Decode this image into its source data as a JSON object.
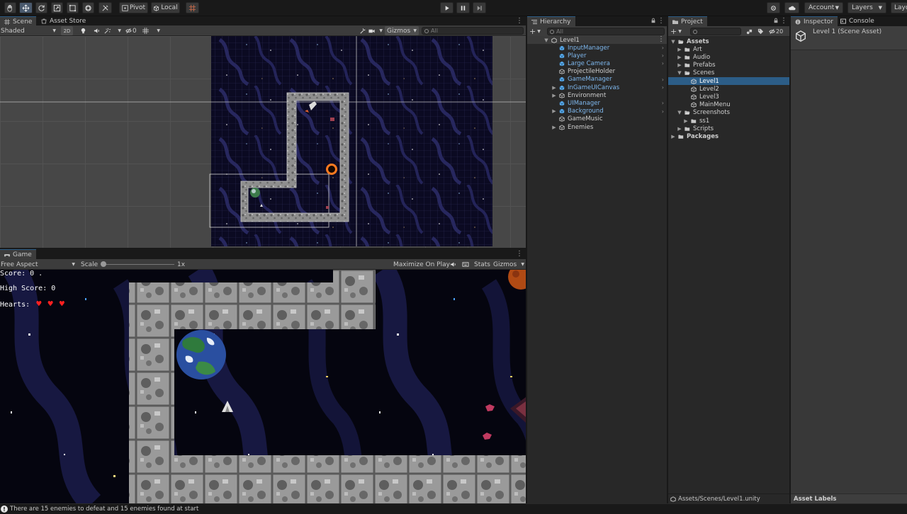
{
  "toolbar": {
    "pivot": "Pivot",
    "local": "Local",
    "account": "Account",
    "layers": "Layers",
    "layout": "Layo"
  },
  "scene": {
    "tabs": {
      "scene": "Scene",
      "asset_store": "Asset Store"
    },
    "shading": "Shaded",
    "mode_2d": "2D",
    "hidden_count": "0",
    "gizmos": "Gizmos",
    "search_placeholder": "All"
  },
  "game": {
    "tab": "Game",
    "aspect": "Free Aspect",
    "scale_label": "Scale",
    "scale_value": "1x",
    "maximize": "Maximize On Play",
    "stats": "Stats",
    "gizmos": "Gizmos",
    "hud": {
      "score": "Score: 0 .",
      "high_score": "High Score: 0",
      "hearts_label": "Hearts:",
      "hearts": [
        "♥",
        "♥",
        "♥"
      ]
    }
  },
  "hierarchy": {
    "tab": "Hierarchy",
    "search_placeholder": "All",
    "scene_name": "Level1",
    "items": [
      {
        "label": "InputManager",
        "prefab": true,
        "expandable": false,
        "arrow": true
      },
      {
        "label": "Player",
        "prefab": true,
        "expandable": false,
        "arrow": true
      },
      {
        "label": "Large Camera",
        "prefab": true,
        "expandable": false,
        "arrow": true
      },
      {
        "label": "ProjectileHolder",
        "prefab": false,
        "expandable": false,
        "arrow": false
      },
      {
        "label": "GameManager",
        "prefab": true,
        "expandable": false,
        "arrow": true
      },
      {
        "label": "InGameUICanvas",
        "prefab": true,
        "expandable": true,
        "arrow": true
      },
      {
        "label": "Environment",
        "prefab": false,
        "expandable": true,
        "arrow": false
      },
      {
        "label": "UIManager",
        "prefab": true,
        "expandable": false,
        "arrow": true
      },
      {
        "label": "Background",
        "prefab": true,
        "expandable": true,
        "arrow": true
      },
      {
        "label": "GameMusic",
        "prefab": false,
        "expandable": false,
        "arrow": false
      },
      {
        "label": "Enemies",
        "prefab": false,
        "expandable": true,
        "arrow": false
      }
    ]
  },
  "project": {
    "tab": "Project",
    "hidden_count": "20",
    "tree": [
      {
        "label": "Assets",
        "depth": 0,
        "kind": "folder-open",
        "bold": true
      },
      {
        "label": "Art",
        "depth": 1,
        "kind": "folder"
      },
      {
        "label": "Audio",
        "depth": 1,
        "kind": "folder"
      },
      {
        "label": "Prefabs",
        "depth": 1,
        "kind": "folder"
      },
      {
        "label": "Scenes",
        "depth": 1,
        "kind": "folder-open"
      },
      {
        "label": "Level1",
        "depth": 2,
        "kind": "scene",
        "selected": true
      },
      {
        "label": "Level2",
        "depth": 2,
        "kind": "scene"
      },
      {
        "label": "Level3",
        "depth": 2,
        "kind": "scene"
      },
      {
        "label": "MainMenu",
        "depth": 2,
        "kind": "scene"
      },
      {
        "label": "Screenshots",
        "depth": 1,
        "kind": "folder-open"
      },
      {
        "label": "ss1",
        "depth": 2,
        "kind": "folder"
      },
      {
        "label": "Scripts",
        "depth": 1,
        "kind": "folder"
      },
      {
        "label": "Packages",
        "depth": 0,
        "kind": "folder",
        "bold": true
      }
    ],
    "path": "Assets/Scenes/Level1.unity"
  },
  "inspector": {
    "tabs": {
      "inspector": "Inspector",
      "console": "Console"
    },
    "title": "Level 1 (Scene Asset)",
    "asset_labels": "Asset Labels"
  },
  "status": {
    "message": "There are 15 enemies to defeat and 15 enemies found at start"
  },
  "colors": {
    "selection": "#2c5d87",
    "prefab_text": "#7fb8ee",
    "heart": "#ff2020"
  }
}
